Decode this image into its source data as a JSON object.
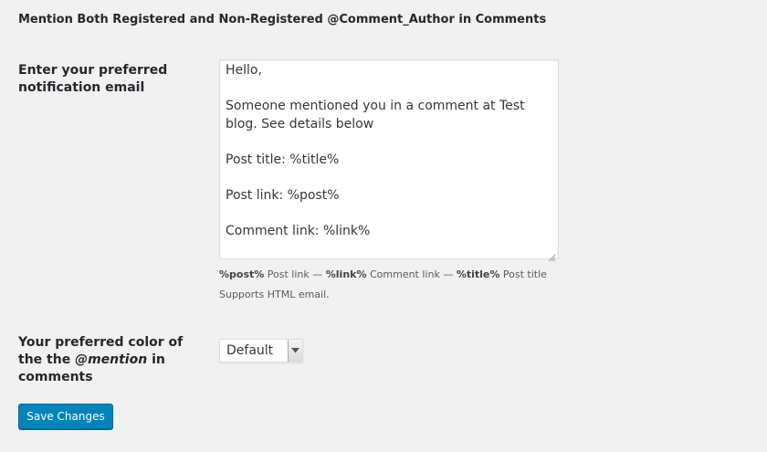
{
  "section": {
    "title": "Mention Both Registered and Non-Registered @Comment_Author in Comments"
  },
  "email": {
    "label": "Enter your preferred notification email",
    "textarea_lines": [
      "Hello,",
      "Someone mentioned you in a comment at Test blog. See details below",
      "Post title: %title%",
      "Post link: %post%",
      "Comment link: %link%"
    ],
    "tokens": [
      {
        "token": "%post%",
        "text": " Post link"
      },
      {
        "token": "%link%",
        "text": " Comment link"
      },
      {
        "token": "%title%",
        "text": " Post title"
      }
    ],
    "separator": " — ",
    "help_text": "Supports HTML email."
  },
  "color": {
    "label_prefix": "Your preferred color of the the",
    "label_em": "@mention",
    "label_suffix": "in comments",
    "selected": "Default"
  },
  "actions": {
    "save_label": "Save Changes",
    "accent": "#0085ba"
  }
}
